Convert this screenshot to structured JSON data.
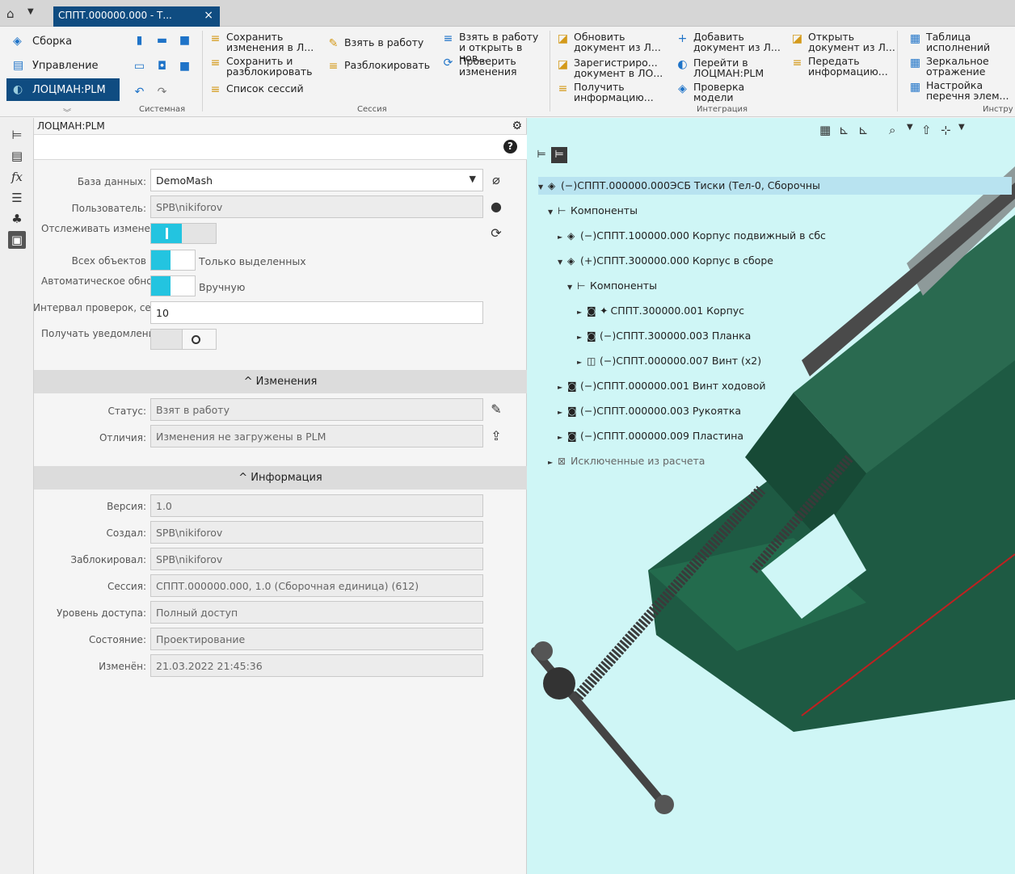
{
  "titlebar": {
    "tab_title": "СППТ.000000.000 - Т...",
    "close": "×"
  },
  "ribbon": {
    "left_nav": [
      {
        "label": "Сборка",
        "icon": "assembly-icon"
      },
      {
        "label": "Управление",
        "icon": "management-icon"
      },
      {
        "label": "ЛОЦМАН:PLM",
        "icon": "plm-icon"
      }
    ],
    "groups": {
      "system": "Системная",
      "session": "Сессия",
      "integration": "Интеграция",
      "tools": "Инстру"
    },
    "session": {
      "save_to_plm": "Сохранить изменения в Л...",
      "save_and_unlock": "Сохранить и разблокировать",
      "session_list": "Список сессий",
      "take_to_work": "Взять в работу",
      "unlock": "Разблокировать",
      "take_open_new": "Взять в работу и открыть в нов...",
      "check_changes": "Проверить изменения"
    },
    "integration": {
      "update_doc": "Обновить документ из Л...",
      "register_doc": "Зарегистриро... документ в ЛО...",
      "get_info": "Получить информацию...",
      "add_doc": "Добавить документ из Л...",
      "go_to_plm": "Перейти в ЛОЦМАН:PLM",
      "check_model": "Проверка модели",
      "open_doc": "Открыть документ из Л...",
      "send_info": "Передать информацию..."
    },
    "tools": {
      "execution_table": "Таблица исполнений",
      "mirror": "Зеркальное отражение",
      "elements_setup": "Настройка перечня элем..."
    }
  },
  "panel": {
    "title": "ЛОЦМАН:PLM",
    "labels": {
      "database": "База данных:",
      "user": "Пользователь:",
      "track_changes": "Отслеживать изменения:",
      "all_objects": "Всех объектов",
      "only_selected": "Только выделенных",
      "auto_update": "Автоматическое обновление",
      "manual": "Вручную",
      "interval": "Интервал проверок, сек:",
      "notifications": "Получать уведомления:"
    },
    "values": {
      "database": "DemoMash",
      "user": "SPB\\nikiforov",
      "interval": "10"
    },
    "changes": {
      "header": "Изменения",
      "status_label": "Статус:",
      "status_value": "Взят в работу",
      "diff_label": "Отличия:",
      "diff_value": "Изменения не загружены в PLM"
    },
    "info": {
      "header": "Информация",
      "rows": [
        {
          "label": "Версия:",
          "value": "1.0"
        },
        {
          "label": "Создал:",
          "value": "SPB\\nikiforov"
        },
        {
          "label": "Заблокировал:",
          "value": "SPB\\nikiforov"
        },
        {
          "label": "Сессия:",
          "value": "СППТ.000000.000, 1.0 (Сборочная единица) (612)"
        },
        {
          "label": "Уровень доступа:",
          "value": "Полный доступ"
        },
        {
          "label": "Состояние:",
          "value": "Проектирование"
        },
        {
          "label": "Изменён:",
          "value": "21.03.2022 21:45:36"
        }
      ]
    }
  },
  "tree": [
    {
      "text": "(−)СППТ.000000.000ЭСБ Тиски (Тел-0, Сборочны",
      "level": 0,
      "icon": "assembly-icon",
      "expanded": true,
      "selected": true
    },
    {
      "text": "Компоненты",
      "level": 1,
      "icon": "components-icon",
      "expanded": true
    },
    {
      "text": "(−)СППТ.100000.000 Корпус подвижный в сбс",
      "level": 2,
      "icon": "assembly-icon",
      "expanded": false
    },
    {
      "text": "(+)СППТ.300000.000 Корпус в сборе",
      "level": 2,
      "icon": "assembly-icon",
      "expanded": true
    },
    {
      "text": "Компоненты",
      "level": 3,
      "icon": "components-icon",
      "expanded": true
    },
    {
      "text": "СППТ.300000.001 Корпус",
      "level": 4,
      "icon": "part-icon",
      "expanded": false,
      "pin": true
    },
    {
      "text": "(−)СППТ.300000.003 Планка",
      "level": 4,
      "icon": "part-icon",
      "expanded": false
    },
    {
      "text": "(−)СППТ.000000.007 Винт (x2)",
      "level": 4,
      "icon": "multi-part-icon",
      "expanded": false
    },
    {
      "text": "(−)СППТ.000000.001 Винт ходовой",
      "level": 2,
      "icon": "part-icon",
      "expanded": false
    },
    {
      "text": "(−)СППТ.000000.003 Рукоятка",
      "level": 2,
      "icon": "part-icon",
      "expanded": false
    },
    {
      "text": "(−)СППТ.000000.009 Пластина",
      "level": 2,
      "icon": "part-icon",
      "expanded": false
    },
    {
      "text": "Исключенные из расчета",
      "level": 1,
      "icon": "excluded-icon",
      "expanded": false,
      "gray": true
    }
  ],
  "colors": {
    "accent": "#0f4c81",
    "toggle_on": "#23c4e0",
    "viewport_bg": "#cff6f6",
    "model_green": "#1e5a43"
  }
}
